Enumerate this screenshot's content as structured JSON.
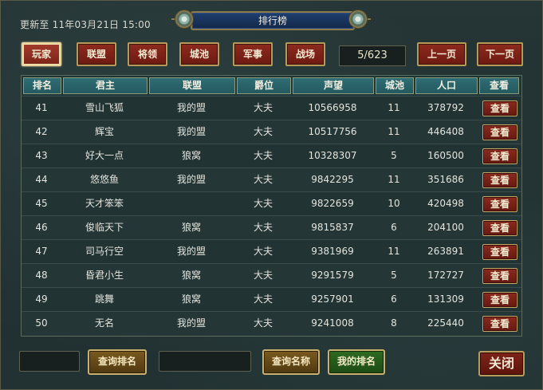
{
  "header": {
    "update_label": "更新至",
    "update_time": "11年03月21日 15:00",
    "title": "排行榜"
  },
  "tabs": [
    {
      "label": "玩家",
      "active": true
    },
    {
      "label": "联盟",
      "active": false
    },
    {
      "label": "将领",
      "active": false
    },
    {
      "label": "城池",
      "active": false
    },
    {
      "label": "军事",
      "active": false
    },
    {
      "label": "战场",
      "active": false
    }
  ],
  "pager": {
    "page": "5/623",
    "prev_label": "上一页",
    "next_label": "下一页"
  },
  "table": {
    "columns": [
      "排名",
      "君主",
      "联盟",
      "爵位",
      "声望",
      "城池",
      "人口",
      "查看"
    ],
    "view_label": "查看",
    "rows": [
      {
        "rank": "41",
        "lord": "雪山飞狐",
        "alliance": "我的盟",
        "title": "大夫",
        "prestige": "10566958",
        "cities": "11",
        "population": "378792"
      },
      {
        "rank": "42",
        "lord": "辉宝",
        "alliance": "我的盟",
        "title": "大夫",
        "prestige": "10517756",
        "cities": "11",
        "population": "446408"
      },
      {
        "rank": "43",
        "lord": "好大一点",
        "alliance": "狼窝",
        "title": "大夫",
        "prestige": "10328307",
        "cities": "5",
        "population": "160500"
      },
      {
        "rank": "44",
        "lord": "悠悠鱼",
        "alliance": "我的盟",
        "title": "大夫",
        "prestige": "9842295",
        "cities": "11",
        "population": "351686"
      },
      {
        "rank": "45",
        "lord": "天才笨笨",
        "alliance": "",
        "title": "大夫",
        "prestige": "9822659",
        "cities": "10",
        "population": "420498"
      },
      {
        "rank": "46",
        "lord": "俊临天下",
        "alliance": "狼窝",
        "title": "大夫",
        "prestige": "9815837",
        "cities": "6",
        "population": "204100"
      },
      {
        "rank": "47",
        "lord": "司马行空",
        "alliance": "我的盟",
        "title": "大夫",
        "prestige": "9381969",
        "cities": "11",
        "population": "263891"
      },
      {
        "rank": "48",
        "lord": "昏君小生",
        "alliance": "狼窝",
        "title": "大夫",
        "prestige": "9291579",
        "cities": "5",
        "population": "172727"
      },
      {
        "rank": "49",
        "lord": "跳舞",
        "alliance": "狼窝",
        "title": "大夫",
        "prestige": "9257901",
        "cities": "6",
        "population": "131309"
      },
      {
        "rank": "50",
        "lord": "无名",
        "alliance": "我的盟",
        "title": "大夫",
        "prestige": "9241008",
        "cities": "8",
        "population": "225440"
      }
    ]
  },
  "footer": {
    "rank_input_value": "",
    "name_input_value": "",
    "query_rank_label": "查询排名",
    "query_name_label": "查询名称",
    "my_rank_label": "我的排名",
    "close_label": "关闭"
  },
  "colors": {
    "tab_red": "#7c2418",
    "header_teal": "#2f6d74",
    "gold_border": "#c8b070",
    "green_button": "#2e6a22"
  }
}
